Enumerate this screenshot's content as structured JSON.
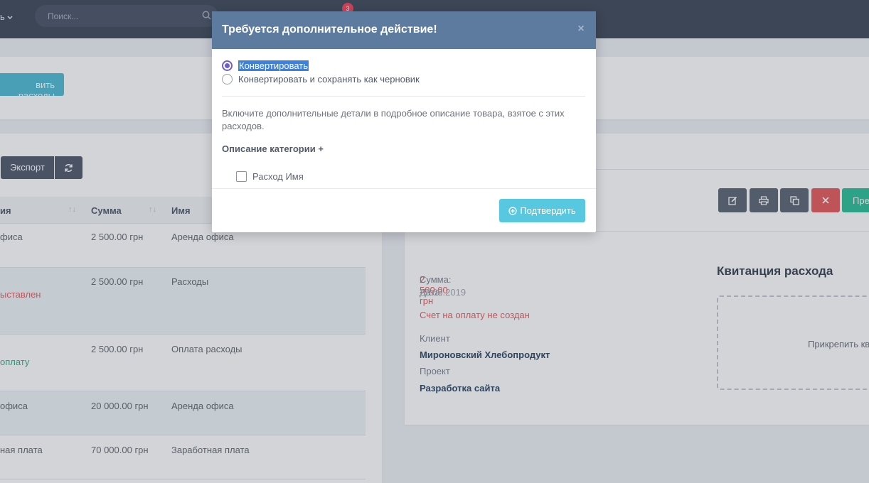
{
  "topbar": {
    "menu_label": "ь",
    "search_placeholder": "Поиск...",
    "notification_count": "3"
  },
  "toolbar": {
    "new_expense_label": "вить расходы",
    "export_label": "Экспорт"
  },
  "table": {
    "headers": {
      "col1": "ия",
      "col2": "Сумма",
      "col3": "Имя"
    },
    "rows": [
      {
        "status": "фиса",
        "amount": "2 500.00 грн",
        "name": "Аренда офиса",
        "note": ""
      },
      {
        "status": "",
        "amount": "2 500.00 грн",
        "name": "Расходы",
        "note": "ыставлен"
      },
      {
        "status": "",
        "amount": "2 500.00 грн",
        "name": "Оплата расходы",
        "note": "оплату"
      },
      {
        "status": "офиса",
        "amount": "20 000.00 грн",
        "name": "Аренда офиса",
        "note": ""
      },
      {
        "status": "ная плата",
        "amount": "70 000.00 грн",
        "name": "Заработная плата",
        "note": ""
      }
    ]
  },
  "details": {
    "amount_label": "Сумма:",
    "amount_value": "2 500.00 грн",
    "date_label": "Дата:",
    "date_value": "22.05.2019",
    "invoice_status": "Счет на оплату не создан",
    "client_label": "Клиент",
    "client_value": "Мироновский Хлебопродукт",
    "project_label": "Проект",
    "project_value": "Разработка сайта",
    "receipt_title": "Квитанция расхода",
    "attach_label": "Прикрепить кв",
    "green_button_label": "Пре"
  },
  "modal": {
    "title": "Требуется дополнительное действие!",
    "close_glyph": "×",
    "option_convert": "Конвертировать",
    "option_convert_draft": "Конвертировать и сохранять как черновик",
    "description": "Включите дополнительные детали в подробное описание товара, взятое с этих расходов.",
    "category_label": "Описание категории +",
    "checkbox_label": "Расход Имя",
    "confirm_label": "Подтвердить"
  },
  "colors": {
    "modal_header": "#5d7b9e",
    "radio_accent": "#6d5cd6",
    "confirm": "#58c7e0",
    "topbar": "#404959",
    "danger": "#e65c5c",
    "success": "#2dbf96"
  }
}
